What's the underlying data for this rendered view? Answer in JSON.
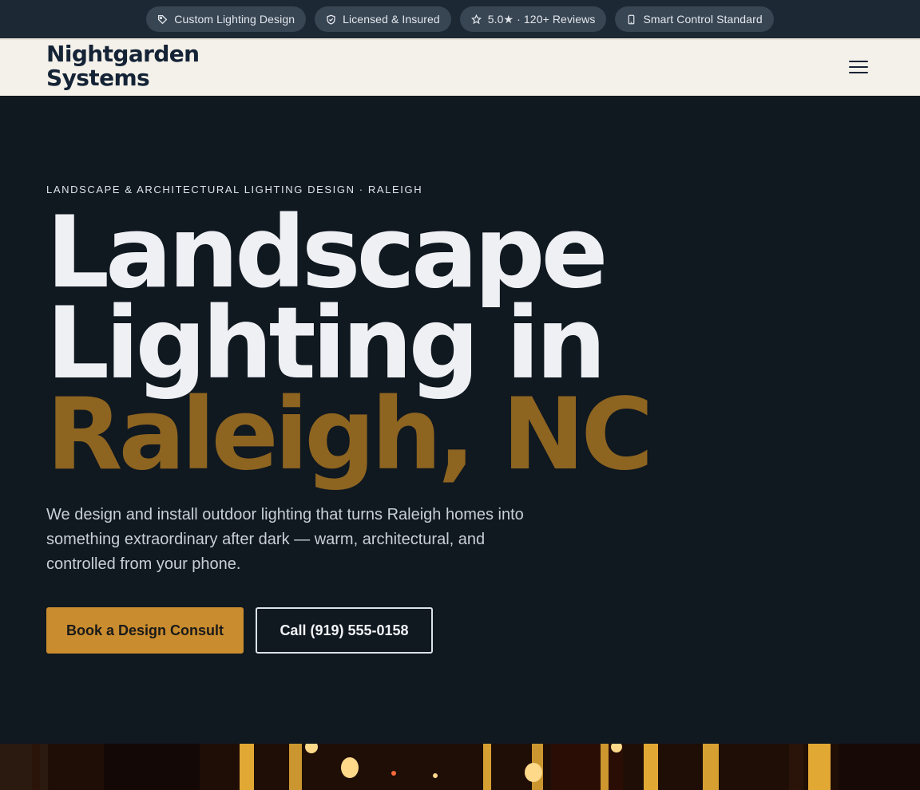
{
  "topbar": {
    "badges": [
      {
        "icon": "tag-icon",
        "label": "Custom Lighting Design"
      },
      {
        "icon": "shield-icon",
        "label": "Licensed & Insured"
      },
      {
        "icon": "star-icon",
        "label": "5.0★ · 120+ Reviews"
      },
      {
        "icon": "phone-icon",
        "label": "Smart Control Standard"
      }
    ]
  },
  "header": {
    "logo_line1": "Nightgarden",
    "logo_line2": "Systems",
    "menu_icon": "hamburger-menu-icon"
  },
  "hero": {
    "eyebrow": "LANDSCAPE & ARCHITECTURAL LIGHTING DESIGN · RALEIGH",
    "headline_line1": "Landscape",
    "headline_line2": "Lighting in",
    "headline_line3": "Raleigh, NC",
    "lead": "We design and install outdoor lighting that turns Raleigh homes into something extraordinary after dark — warm, architectural, and controlled from your phone.",
    "cta_primary": "Book a Design Consult",
    "cta_secondary": "Call (919) 555-0158"
  },
  "colors": {
    "topbar_bg": "#1c2834",
    "header_bg": "#f4f1ea",
    "hero_bg": "#101820",
    "accent": "#c98c2e",
    "headline_accent": "#8d6420"
  }
}
